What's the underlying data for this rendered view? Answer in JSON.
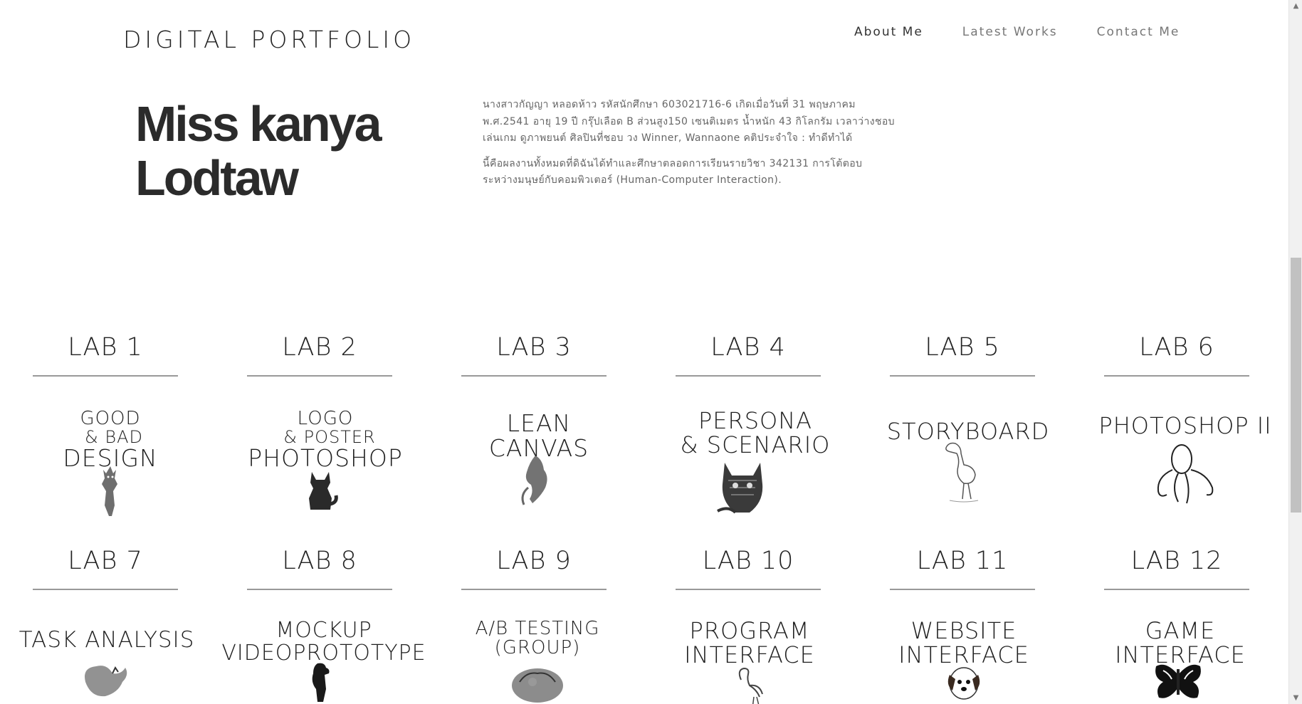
{
  "header": {
    "brand": "DIGITAL PORTFOLIO",
    "nav": [
      {
        "label": "About Me",
        "active": true
      },
      {
        "label": "Latest Works",
        "active": false
      },
      {
        "label": "Contact Me",
        "active": false
      }
    ]
  },
  "hero": {
    "name_line1": "Miss kanya",
    "name_line2": "Lodtaw",
    "bio_p1": "นางสาวกัญญา หลอดห้าว รหัสนักศึกษา 603021716-6 เกิดเมื่อวันที่ 31 พฤษภาคม พ.ศ.2541 อายุ 19 ปี กรุ๊ปเลือด B ส่วนสูง150 เซนติเมตร น้ำหนัก 43 กิโลกรัม เวลาว่างชอบเล่นเกม ดูภาพยนต์ ศิลปินที่ชอบ วง Winner, Wannaone คติประจำใจ : ทำดีทำได้",
    "bio_p2": "นี้คือผลงานทั้งหมดที่ดิฉันได้ทำและศึกษาตลอดการเรียนรายวิชา 342131 การโต้ตอบระหว่างมนุษย์กับคอมพิวเตอร์ (Human-Computer Interaction)."
  },
  "labs": [
    {
      "title": "LAB 1",
      "lines": [
        "GOOD",
        "& BAD",
        "DESIGN"
      ],
      "art": "fox-watercolor"
    },
    {
      "title": "LAB 2",
      "lines": [
        "LOGO",
        "& POSTER",
        "PHOTOSHOP"
      ],
      "art": "fox-sitting"
    },
    {
      "title": "LAB 3",
      "lines": [
        "LEAN",
        "CANVAS"
      ],
      "art": "fox-ink"
    },
    {
      "title": "LAB 4",
      "lines": [
        "PERSONA",
        "& SCENARIO"
      ],
      "art": "cat-sketch"
    },
    {
      "title": "LAB 5",
      "lines": [
        "STORYBOARD"
      ],
      "art": "spoonbill-bird"
    },
    {
      "title": "LAB 6",
      "lines": [
        "PHOTOSHOP II"
      ],
      "art": "octopus"
    },
    {
      "title": "LAB 7",
      "lines": [
        "TASK ANALYSIS"
      ],
      "art": "rooster"
    },
    {
      "title": "LAB 8",
      "lines": [
        "MOCKUP",
        "VIDEOPROTOTYPE"
      ],
      "art": "dog-standing"
    },
    {
      "title": "LAB 9",
      "lines": [
        "A/B TESTING",
        "(GROUP)"
      ],
      "art": "sleeping-fox"
    },
    {
      "title": "LAB 10",
      "lines": [
        "PROGRAM",
        "INTERFACE"
      ],
      "art": "flamingo"
    },
    {
      "title": "LAB 11",
      "lines": [
        "WEBSITE",
        "INTERFACE"
      ],
      "art": "puppy"
    },
    {
      "title": "LAB 12",
      "lines": [
        "GAME",
        "INTERFACE"
      ],
      "art": "butterfly"
    }
  ],
  "colors": {
    "text_dark": "#2b2b2b",
    "nav_active": "#333333",
    "nav_inactive": "#777777",
    "divider": "#999999",
    "scroll_thumb": "#c1c1c1"
  }
}
